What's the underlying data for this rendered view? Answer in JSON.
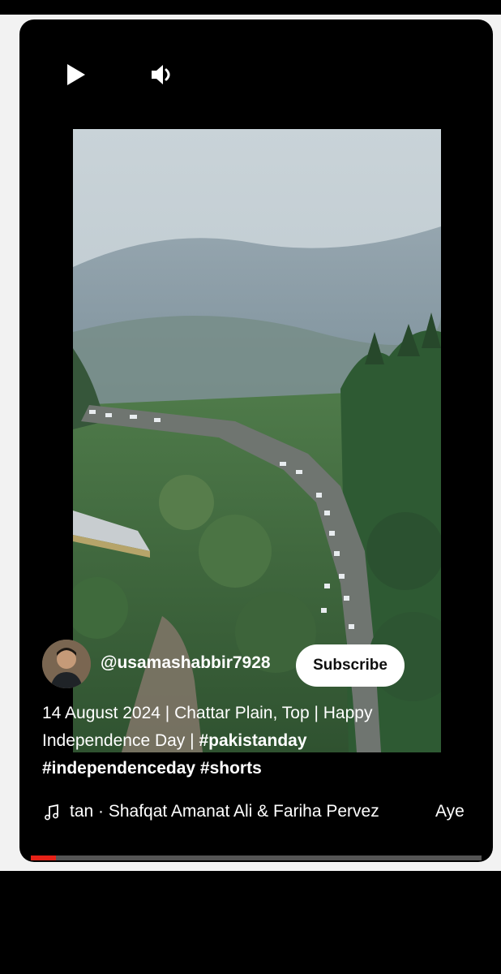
{
  "player": {
    "controls": {
      "play_icon": "play-icon",
      "volume_icon": "volume-icon"
    },
    "channel": {
      "handle": "@usamashabbir7928",
      "subscribe_label": "Subscribe"
    },
    "title": {
      "line1": "14 August 2024 | Chattar Plain, Top | Happy",
      "line2_plain": "Independence Day | ",
      "line2_tag": "#pakistanday",
      "line3_tags": "#independenceday #shorts"
    },
    "music": {
      "icon": "music-note-icon",
      "text": "tan · Shafqat Amanat Ali & Fariha Pervez",
      "next": "Aye"
    },
    "progress": {
      "fraction": 0.055
    },
    "colors": {
      "accent": "#e62117",
      "background": "#000000",
      "page": "#f2f2f2"
    }
  }
}
